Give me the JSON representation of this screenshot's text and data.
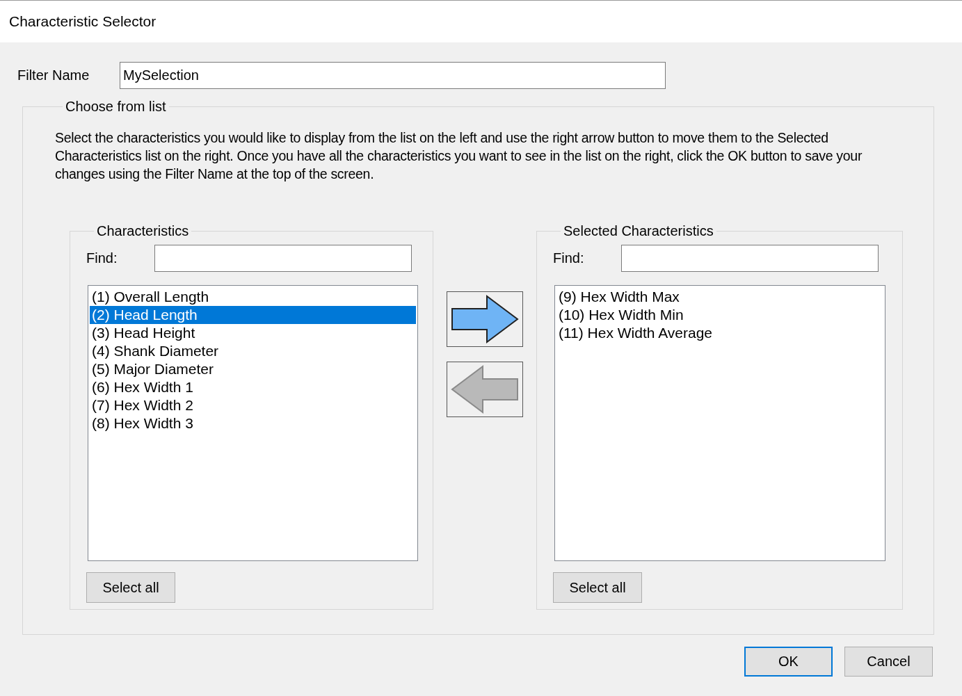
{
  "window": {
    "title": "Characteristic Selector"
  },
  "filter_name": {
    "label": "Filter Name",
    "value": "MySelection"
  },
  "group": {
    "title": "Choose from list",
    "instructions": "Select the characteristics you would like to display from the list on the left and use the right arrow button to move them to the Selected Characteristics list on the right. Once you have all the characteristics you want to see in the list on the right, click the OK button to save your changes using the Filter Name at the top of the screen."
  },
  "lists": [
    {
      "title": "Characteristics",
      "find_label": "Find:",
      "select_all": "Select all",
      "items": [
        {
          "label": "(1) Overall Length",
          "selected": false
        },
        {
          "label": "(2) Head Length",
          "selected": true
        },
        {
          "label": "(3) Head Height",
          "selected": false
        },
        {
          "label": "(4) Shank Diameter",
          "selected": false
        },
        {
          "label": "(5) Major Diameter",
          "selected": false
        },
        {
          "label": "(6) Hex Width 1",
          "selected": false
        },
        {
          "label": "(7) Hex Width 2",
          "selected": false
        },
        {
          "label": "(8) Hex Width 3",
          "selected": false
        }
      ]
    },
    {
      "title": "Selected Characteristics",
      "find_label": "Find:",
      "select_all": "Select all",
      "items": [
        {
          "label": "(9) Hex Width Max",
          "selected": false
        },
        {
          "label": "(10) Hex Width Min",
          "selected": false
        },
        {
          "label": "(11) Hex Width Average",
          "selected": false
        }
      ]
    }
  ],
  "buttons": [
    {
      "label": "OK",
      "default": true
    },
    {
      "label": "Cancel",
      "default": false
    }
  ]
}
